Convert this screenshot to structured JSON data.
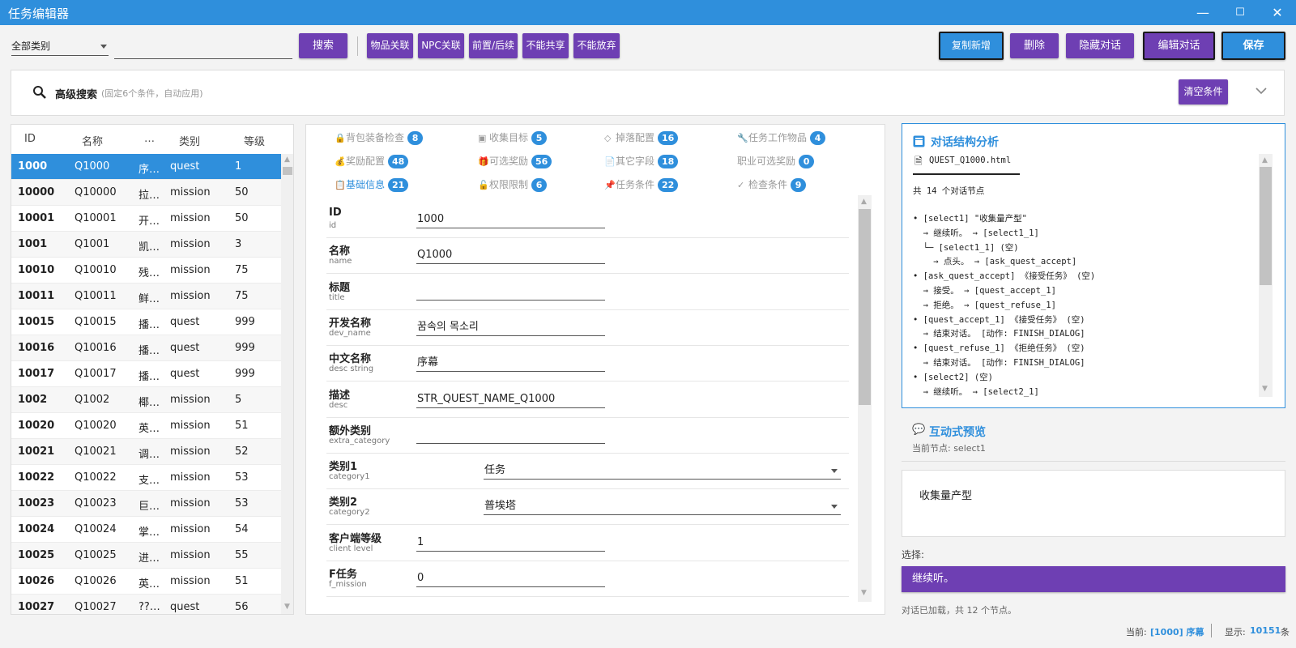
{
  "app": {
    "title": "任务编辑器"
  },
  "window": {
    "minimize_glyph": "—",
    "maximize_glyph": "☐",
    "close_glyph": "✕"
  },
  "toolbar": {
    "category_value": "全部类别",
    "search_value": "",
    "search_label": "搜索",
    "link_buttons": [
      "物品关联",
      "NPC关联",
      "前置/后续",
      "不能共享",
      "不能放弃"
    ],
    "copy_new_label": "复制新增",
    "delete_label": "删除",
    "hide_dialog_label": "隐藏对话",
    "edit_dialog_label": "编辑对话",
    "save_label": "保存"
  },
  "advanced_search": {
    "title": "高级搜索",
    "hint": "(固定6个条件，自动应用)",
    "clear_label": "清空条件"
  },
  "quest_list": {
    "headers": {
      "id": "ID",
      "name": "名称",
      "dots": "…",
      "type": "类别",
      "level": "等级"
    },
    "rows": [
      {
        "id": "1000",
        "name": "Q1000",
        "desc": "序…",
        "type": "quest",
        "level": "1"
      },
      {
        "id": "10000",
        "name": "Q10000",
        "desc": "拉…",
        "type": "mission",
        "level": "50"
      },
      {
        "id": "10001",
        "name": "Q10001",
        "desc": "开…",
        "type": "mission",
        "level": "50"
      },
      {
        "id": "1001",
        "name": "Q1001",
        "desc": "凯…",
        "type": "mission",
        "level": "3"
      },
      {
        "id": "10010",
        "name": "Q10010",
        "desc": "残…",
        "type": "mission",
        "level": "75"
      },
      {
        "id": "10011",
        "name": "Q10011",
        "desc": "鲜…",
        "type": "mission",
        "level": "75"
      },
      {
        "id": "10015",
        "name": "Q10015",
        "desc": "播…",
        "type": "quest",
        "level": "999"
      },
      {
        "id": "10016",
        "name": "Q10016",
        "desc": "播…",
        "type": "quest",
        "level": "999"
      },
      {
        "id": "10017",
        "name": "Q10017",
        "desc": "播…",
        "type": "quest",
        "level": "999"
      },
      {
        "id": "1002",
        "name": "Q1002",
        "desc": "椰…",
        "type": "mission",
        "level": "5"
      },
      {
        "id": "10020",
        "name": "Q10020",
        "desc": "英…",
        "type": "mission",
        "level": "51"
      },
      {
        "id": "10021",
        "name": "Q10021",
        "desc": "调…",
        "type": "mission",
        "level": "52"
      },
      {
        "id": "10022",
        "name": "Q10022",
        "desc": "支…",
        "type": "mission",
        "level": "53"
      },
      {
        "id": "10023",
        "name": "Q10023",
        "desc": "巨…",
        "type": "mission",
        "level": "53"
      },
      {
        "id": "10024",
        "name": "Q10024",
        "desc": "掌…",
        "type": "mission",
        "level": "54"
      },
      {
        "id": "10025",
        "name": "Q10025",
        "desc": "进…",
        "type": "mission",
        "level": "55"
      },
      {
        "id": "10026",
        "name": "Q10026",
        "desc": "英…",
        "type": "mission",
        "level": "51"
      },
      {
        "id": "10027",
        "name": "Q10027",
        "desc": "??…",
        "type": "quest",
        "level": "56"
      }
    ]
  },
  "tabs": [
    {
      "label": "背包装备检查",
      "count": "8",
      "icon": "🔒",
      "icon_name": "lock-icon"
    },
    {
      "label": "收集目标",
      "count": "5",
      "icon": "▣",
      "icon_name": "box-icon"
    },
    {
      "label": "掉落配置",
      "count": "16",
      "icon": "◇",
      "icon_name": "gem-icon"
    },
    {
      "label": "任务工作物品",
      "count": "4",
      "icon": "🔧",
      "icon_name": "wrench-icon"
    },
    {
      "label": "奖励配置",
      "count": "48",
      "icon": "💰",
      "icon_name": "money-bag-icon"
    },
    {
      "label": "可选奖励",
      "count": "56",
      "icon": "🎁",
      "icon_name": "gift-icon"
    },
    {
      "label": "其它字段",
      "count": "18",
      "icon": "📄",
      "icon_name": "document-icon"
    },
    {
      "label": "职业可选奖励",
      "count": "0",
      "icon": "",
      "icon_name": ""
    },
    {
      "label": "基础信息",
      "count": "21",
      "icon": "📋",
      "icon_name": "clipboard-icon",
      "active": true
    },
    {
      "label": "权限限制",
      "count": "6",
      "icon": "🔓",
      "icon_name": "unlock-icon"
    },
    {
      "label": "任务条件",
      "count": "22",
      "icon": "📌",
      "icon_name": "pin-icon"
    },
    {
      "label": "检查条件",
      "count": "9",
      "icon": "✓",
      "icon_name": "check-icon"
    }
  ],
  "fields": [
    {
      "label": "ID",
      "key": "id",
      "value": "1000",
      "kind": "text"
    },
    {
      "label": "名称",
      "key": "name",
      "value": "Q1000",
      "kind": "text"
    },
    {
      "label": "标题",
      "key": "title",
      "value": "",
      "kind": "text"
    },
    {
      "label": "开发名称",
      "key": "dev_name",
      "value": "꿈속의 목소리",
      "kind": "text"
    },
    {
      "label": "中文名称",
      "key": "desc string",
      "value": "序幕",
      "kind": "text"
    },
    {
      "label": "描述",
      "key": "desc",
      "value": "STR_QUEST_NAME_Q1000",
      "kind": "text"
    },
    {
      "label": "额外类别",
      "key": "extra_category",
      "value": "",
      "kind": "text"
    },
    {
      "label": "类别1",
      "key": "category1",
      "value": "任务",
      "kind": "select"
    },
    {
      "label": "类别2",
      "key": "category2",
      "value": "普埃塔",
      "kind": "select"
    },
    {
      "label": "客户端等级",
      "key": "client level",
      "value": "1",
      "kind": "text"
    },
    {
      "label": "F任务",
      "key": "f_mission",
      "value": "0",
      "kind": "text"
    }
  ],
  "dialog_analysis": {
    "title": "对话结构分析",
    "file": "QUEST_Q1000.html",
    "summary": "共 14 个对话节点",
    "tree": [
      "• [select1] \"收集量产型\"",
      "  → 继续听。 → [select1_1]",
      "  └─ [select1_1] (空)",
      "    → 点头。 → [ask_quest_accept]",
      "• [ask_quest_accept] 《接受任务》 (空)",
      "  → 接受。 → [quest_accept_1]",
      "  → 拒绝。 → [quest_refuse_1]",
      "• [quest_accept_1] 《接受任务》 (空)",
      "  → 结束对话。 [动作: FINISH_DIALOG]",
      "• [quest_refuse_1] 《拒绝任务》 (空)",
      "  → 结束对话。 [动作: FINISH_DIALOG]",
      "• [select2] (空)",
      "  → 继续听。 → [select2_1]"
    ]
  },
  "preview": {
    "title": "互动式预览",
    "current_node": "当前节点: select1",
    "dialog_text": "收集量产型",
    "choices_label": "选择:",
    "choice": "继续听。",
    "status": "对话已加载，共 12 个节点。"
  },
  "statusbar": {
    "current_label": "当前:",
    "current_value": "[1000] 序幕",
    "display_label": "显示:",
    "display_count": "10151",
    "display_unit": "条"
  },
  "colors": {
    "accent": "#2f8fdc",
    "purple": "#6e3fb3"
  }
}
